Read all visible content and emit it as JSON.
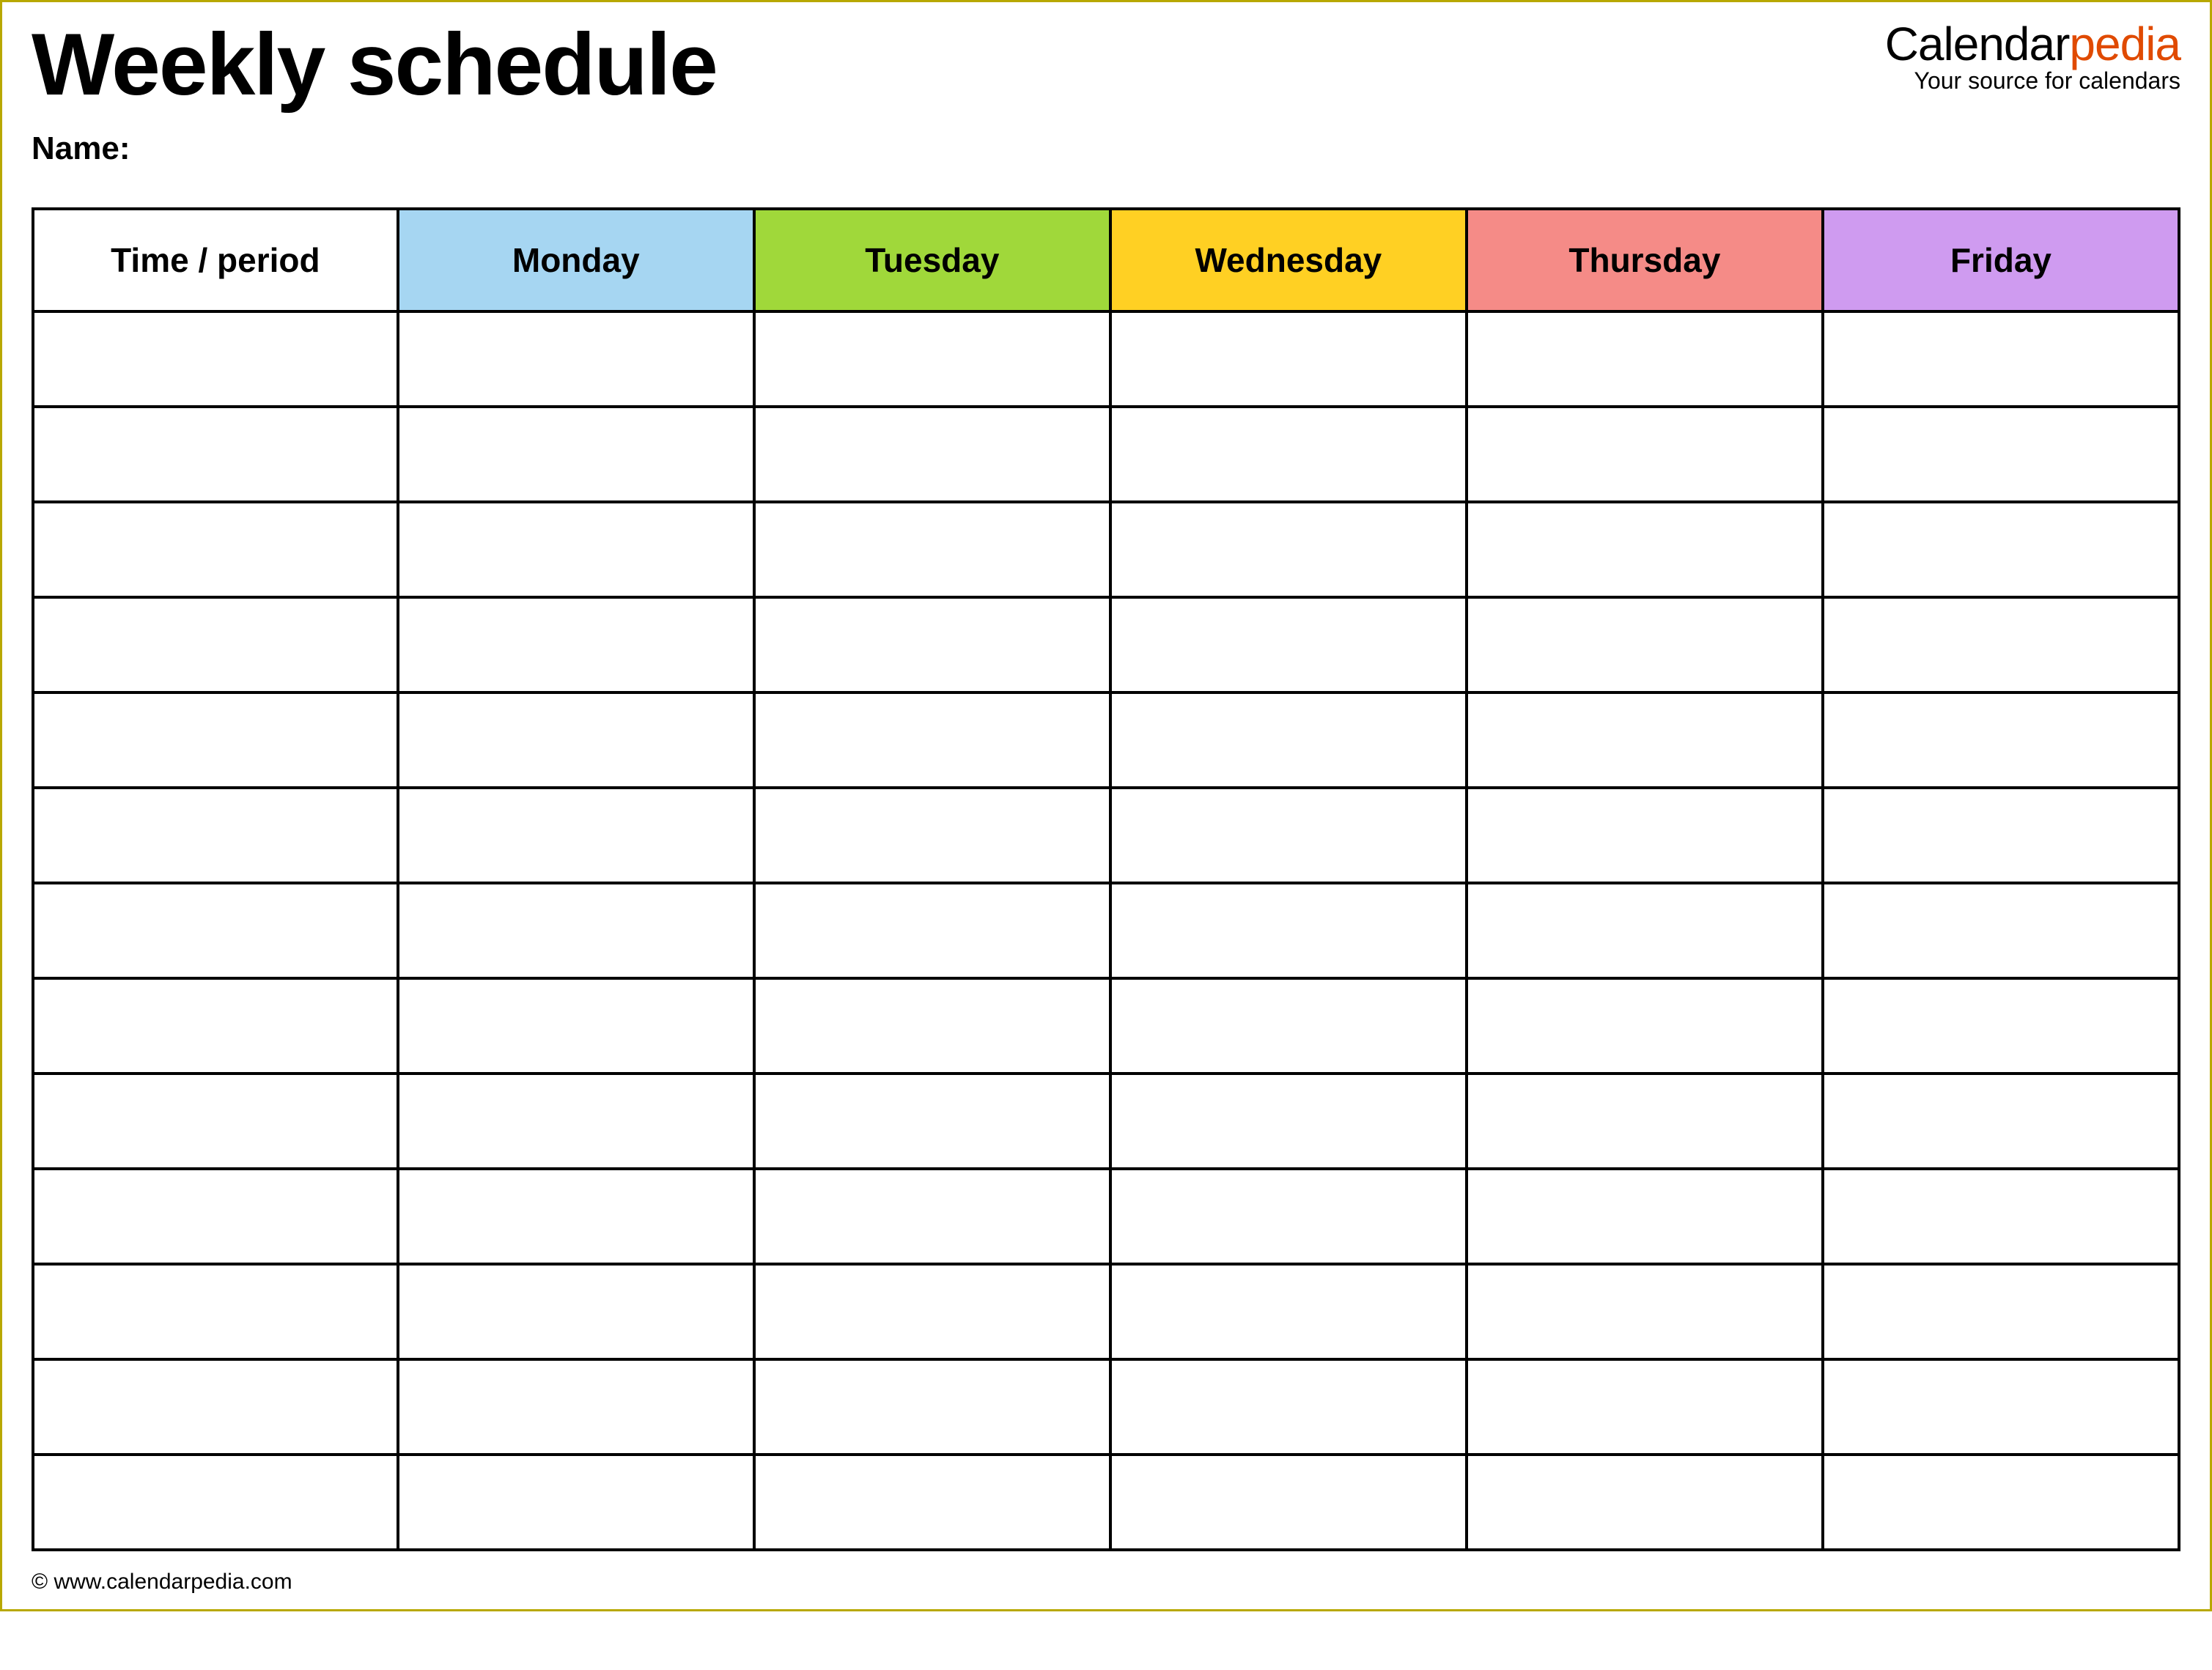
{
  "header": {
    "title": "Weekly schedule",
    "name_label": "Name:",
    "brand_part1": "Calendar",
    "brand_part2": "pedia",
    "brand_tagline": "Your source for calendars"
  },
  "columns": {
    "time": "Time / period",
    "days": [
      {
        "label": "Monday",
        "color": "#a6d6f2"
      },
      {
        "label": "Tuesday",
        "color": "#a0d83a"
      },
      {
        "label": "Wednesday",
        "color": "#ffd023"
      },
      {
        "label": "Thursday",
        "color": "#f58b87"
      },
      {
        "label": "Friday",
        "color": "#cf9bf0"
      }
    ]
  },
  "row_count": 13,
  "footer": {
    "copyright": "© www.calendarpedia.com"
  }
}
